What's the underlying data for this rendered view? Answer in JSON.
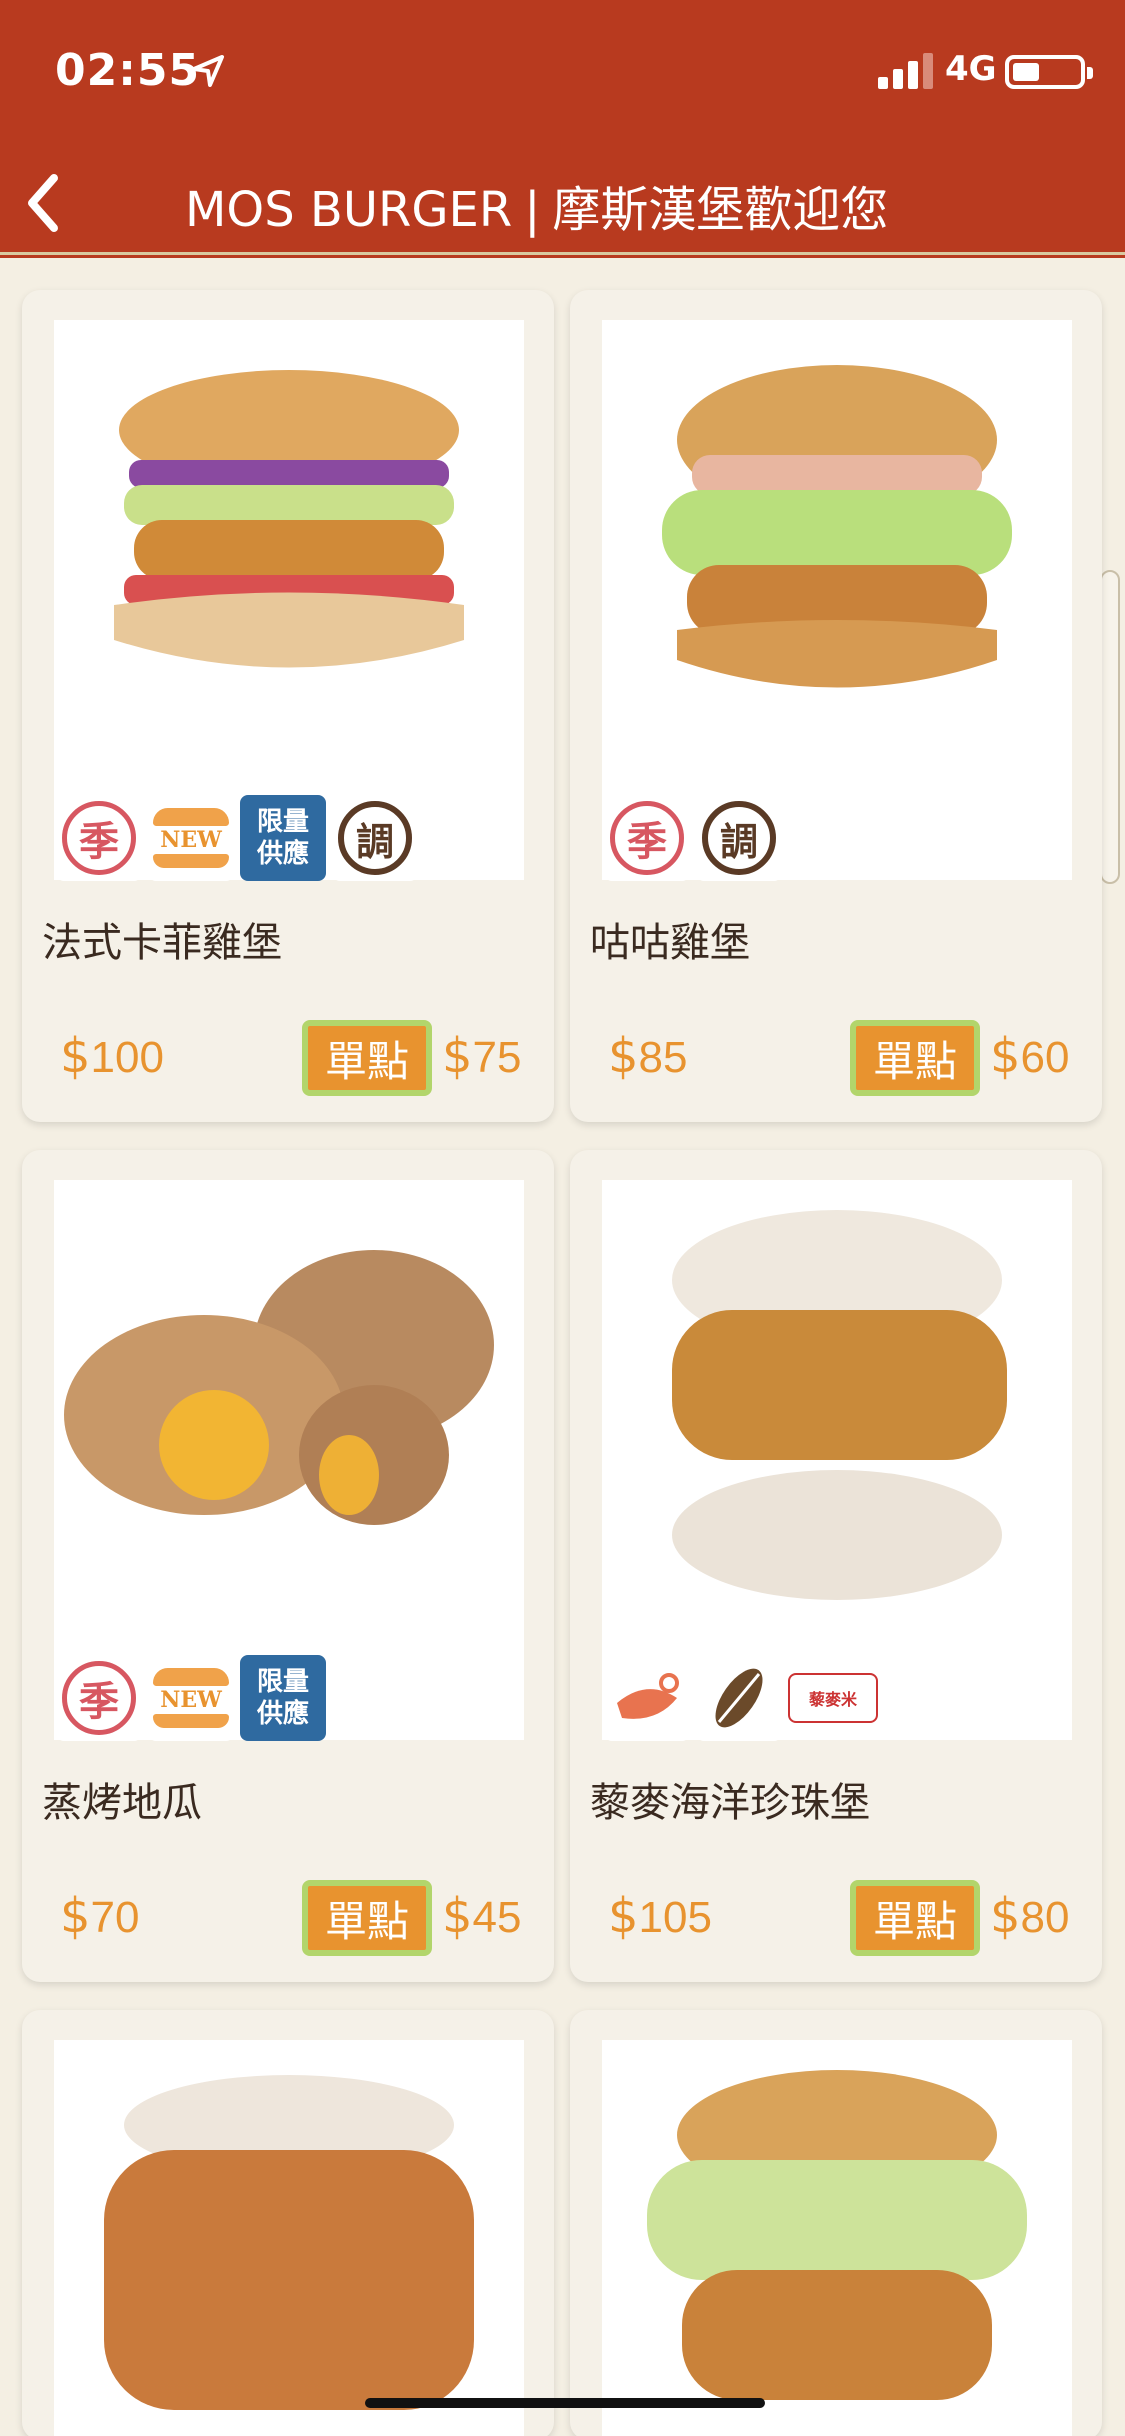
{
  "status": {
    "time": "02:55",
    "network": "4G"
  },
  "nav": {
    "title_en": "MOS BURGER",
    "separator": "|",
    "title_zh": "摩斯漢堡歡迎您"
  },
  "colors": {
    "header": "#b83a1f",
    "accent_orange": "#e8932f",
    "background": "#f4efe3"
  },
  "items": [
    {
      "name": "法式卡菲雞堡",
      "set_price": "100",
      "single_label": "單點",
      "single_price": "75",
      "badges": [
        "季",
        "NEW",
        "限量供應",
        "調"
      ]
    },
    {
      "name": "咕咕雞堡",
      "set_price": "85",
      "single_label": "單點",
      "single_price": "60",
      "badges": [
        "季",
        "調"
      ]
    },
    {
      "name": "蒸烤地瓜",
      "set_price": "70",
      "single_label": "單點",
      "single_price": "45",
      "badges": [
        "季",
        "NEW",
        "限量供應"
      ]
    },
    {
      "name": "藜麥海洋珍珠堡",
      "set_price": "105",
      "single_label": "單點",
      "single_price": "80",
      "badges": [
        "seafood-icon",
        "grain-icon",
        "藜麥米"
      ]
    }
  ],
  "badge_text": {
    "season": "季",
    "new": "NEW",
    "limit_1": "限量",
    "limit_2": "供應",
    "adjust": "調",
    "quinoa": "藜麥米"
  },
  "currency": "$"
}
